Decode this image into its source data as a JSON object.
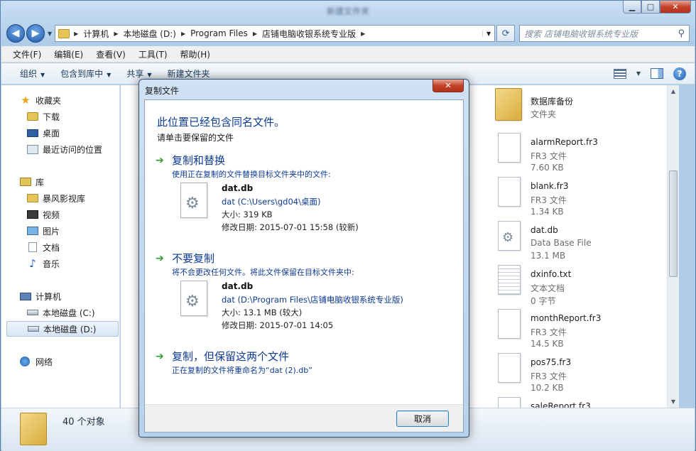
{
  "explorer": {
    "window_title": "新建文件夹",
    "address": {
      "segments": [
        "计算机",
        "本地磁盘 (D:)",
        "Program Files",
        "店铺电脑收银系统专业版"
      ]
    },
    "search_placeholder": "搜索 店铺电脑收银系统专业版",
    "menu": [
      "文件(F)",
      "编辑(E)",
      "查看(V)",
      "工具(T)",
      "帮助(H)"
    ],
    "toolbar": {
      "organize": "组织",
      "include_library": "包含到库中",
      "share": "共享",
      "new_folder": "新建文件夹"
    },
    "navpane": {
      "favorites": "收藏夹",
      "downloads": "下载",
      "desktop": "桌面",
      "recent": "最近访问的位置",
      "libraries": "库",
      "baofeng": "暴风影视库",
      "videos": "视频",
      "pictures": "图片",
      "documents": "文档",
      "music": "音乐",
      "computer": "计算机",
      "disk_c": "本地磁盘 (C:)",
      "disk_d": "本地磁盘 (D:)",
      "network": "网络"
    },
    "files": [
      {
        "name": "数据库备份",
        "type": "文件夹",
        "size": ""
      },
      {
        "name": "alarmReport.fr3",
        "type": "FR3 文件",
        "size": "7.60 KB"
      },
      {
        "name": "blank.fr3",
        "type": "FR3 文件",
        "size": "1.34 KB"
      },
      {
        "name": "dat.db",
        "type": "Data Base File",
        "size": "13.1 MB"
      },
      {
        "name": "dxinfo.txt",
        "type": "文本文档",
        "size": "0 字节"
      },
      {
        "name": "monthReport.fr3",
        "type": "FR3 文件",
        "size": "14.5 KB"
      },
      {
        "name": "pos75.fr3",
        "type": "FR3 文件",
        "size": "10.2 KB"
      },
      {
        "name": "saleReport.fr3",
        "type": "",
        "size": ""
      }
    ],
    "status": {
      "count": "40 个对象"
    }
  },
  "dialog": {
    "title": "复制文件",
    "close_label": "✕",
    "main_instruction": "此位置已经包含同名文件。",
    "sub_instruction": "请单击要保留的文件",
    "options": {
      "replace": {
        "title": "复制和替换",
        "desc": "使用正在复制的文件替换目标文件夹中的文件:",
        "file_name": "dat.db",
        "path": "dat (C:\\Users\\gd04\\桌面)",
        "size": "大小: 319 KB",
        "date": "修改日期: 2015-07-01 15:58 (较新)"
      },
      "skip": {
        "title": "不要复制",
        "desc": "将不会更改任何文件。将此文件保留在目标文件夹中:",
        "file_name": "dat.db",
        "path": "dat (D:\\Program Files\\店铺电脑收银系统专业版)",
        "size": "大小: 13.1 MB (较大)",
        "date": "修改日期: 2015-07-01 14:05"
      },
      "keep_both": {
        "title": "复制，但保留这两个文件",
        "desc": "正在复制的文件将重命名为“dat (2).db”"
      }
    },
    "cancel_label": "取消"
  }
}
